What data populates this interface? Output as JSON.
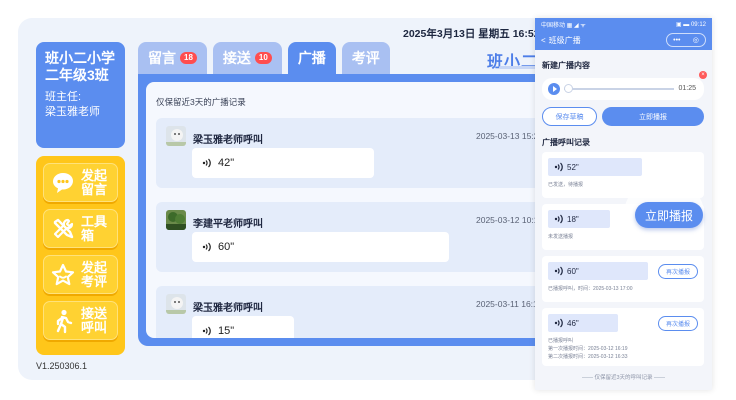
{
  "tablet": {
    "datetime": "2025年3月13日 星期五 16:52:3",
    "class_name": "班小二小学二年级3班",
    "teacher_label": "班主任:",
    "teacher_name": "梁玉雅老师",
    "version": "V1.250306.1",
    "logo_text": "班小二",
    "features": [
      {
        "label": "发起留言",
        "icon": "message-bubble-icon"
      },
      {
        "label": "工具箱",
        "icon": "tools-icon"
      },
      {
        "label": "发起考评",
        "icon": "star-icon"
      },
      {
        "label": "接送呼叫",
        "icon": "walking-person-icon"
      }
    ],
    "tabs": [
      {
        "label": "留言",
        "badge": "18"
      },
      {
        "label": "接送",
        "badge": "10"
      },
      {
        "label": "广播",
        "badge": ""
      },
      {
        "label": "考评",
        "badge": ""
      }
    ],
    "active_tab": "广播",
    "hint": "仅保留近3天的广播记录",
    "records": [
      {
        "name": "梁玉雅老师呼叫",
        "time": "2025-03-13 15:2",
        "duration": "42\""
      },
      {
        "name": "李建平老师呼叫",
        "time": "2025-03-12 10:1",
        "duration": "60\""
      },
      {
        "name": "梁玉雅老师呼叫",
        "time": "2025-03-11 16:1",
        "duration": "15\""
      }
    ]
  },
  "phone": {
    "status_left": "中国移动 ▦ ◢ ᯤ",
    "status_right": "▣ ▬ 09:12",
    "nav_back": "<",
    "nav_title": "班级广播",
    "capsule_more": "•••",
    "capsule_close": "◎",
    "new_section": "新建广播内容",
    "player_duration": "01:25",
    "delete_symbol": "×",
    "save_draft": "保存草稿",
    "broadcast_now": "立即播报",
    "history_section": "广播呼叫记录",
    "history": [
      {
        "duration": "52\"",
        "status": "已发送，待播报",
        "extra": "",
        "button": ""
      },
      {
        "duration": "18\"",
        "status": "未发送播报",
        "extra": "",
        "button": ""
      },
      {
        "duration": "60\"",
        "status": "已播报呼叫，时间：2025-03-13 17:00",
        "extra": "",
        "button": "再次播报"
      },
      {
        "duration": "46\"",
        "status": "已播报呼叫",
        "extra": "第一次播报时间：2025-03-12 16:19\n第二次播报时间：2025-03-12 16:33",
        "button": "再次播报"
      }
    ],
    "footer": "—— 仅保留近3天的呼叫记录 ——",
    "float_button": "立即播报"
  },
  "colors": {
    "primary": "#5b8def",
    "tab_inactive": "#a9c0f2",
    "feature_yellow": "#ffc61a",
    "badge_red": "#ff4d4f"
  }
}
